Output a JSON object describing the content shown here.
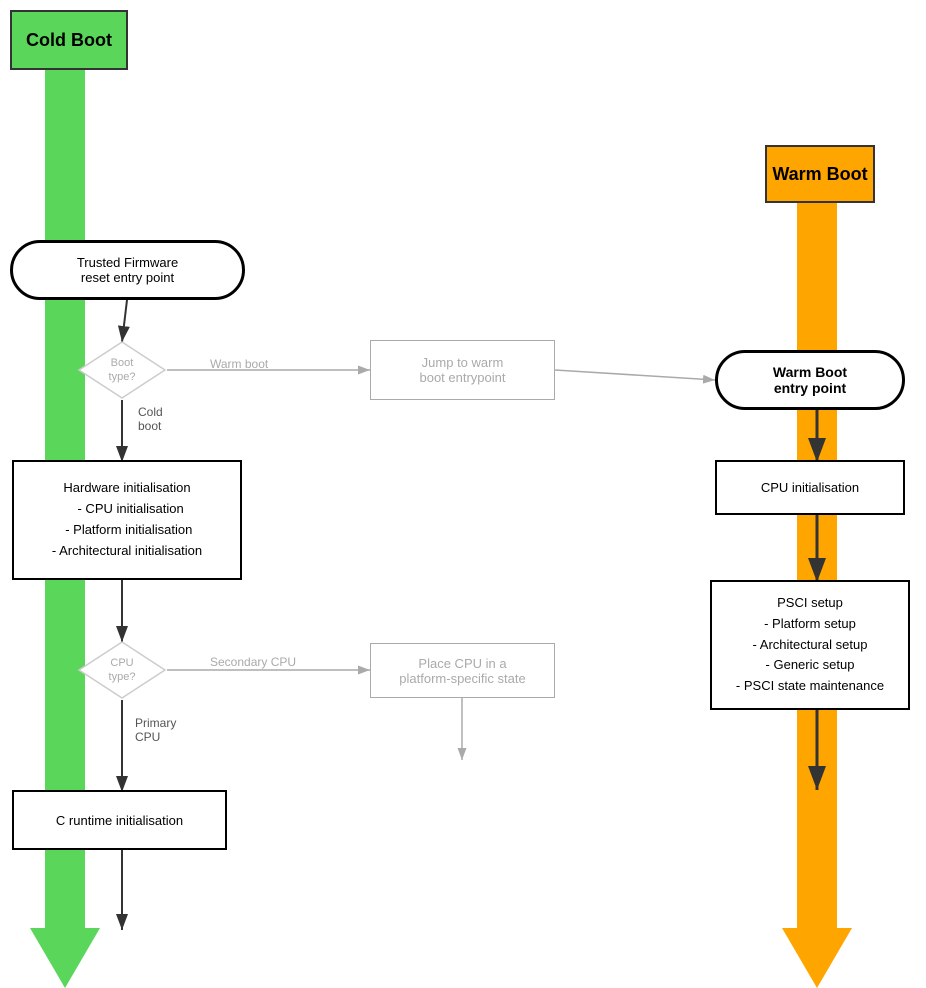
{
  "cold_boot": {
    "label": "Cold Boot",
    "color": "#5ad65a"
  },
  "warm_boot": {
    "label": "Warm Boot",
    "color": "#ffa500"
  },
  "trusted_firmware": {
    "text": "Trusted Firmware\nreset entry point"
  },
  "boot_type_diamond": {
    "label": "Boot\ntype?"
  },
  "warm_boot_label_arrow": "Warm boot",
  "cold_boot_label_arrow": "Cold\nboot",
  "jump_warm_boot": {
    "text": "Jump to warm\nboot entrypoint"
  },
  "warm_boot_entry": {
    "text": "Warm Boot\nentry point"
  },
  "hw_init": {
    "text": "Hardware initialisation\n  - CPU initialisation\n - Platform initialisation\n- Architectural initialisation"
  },
  "cpu_type_diamond": {
    "label": "CPU\ntype?"
  },
  "secondary_cpu_label": "Secondary CPU",
  "primary_cpu_label": "Primary\nCPU",
  "place_cpu": {
    "text": "Place CPU in a\nplatform-specific state"
  },
  "c_runtime": {
    "text": "C runtime initialisation"
  },
  "cpu_init_warm": {
    "text": "CPU initialisation"
  },
  "psci_setup": {
    "text": "PSCI setup\n- Platform setup\n- Architectural setup\n- Generic setup\n- PSCI state maintenance"
  }
}
